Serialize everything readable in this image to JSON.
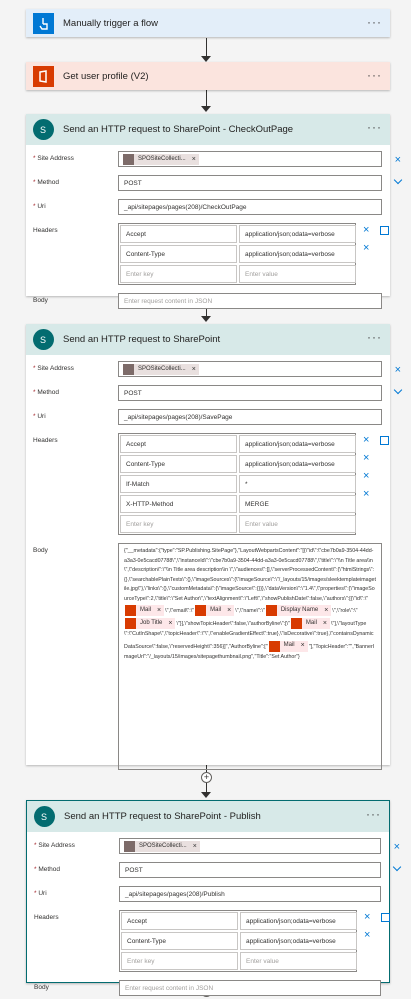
{
  "steps": {
    "trigger": {
      "title": "Manually trigger a flow"
    },
    "profile": {
      "title": "Get user profile (V2)"
    },
    "checkout": {
      "title": "Send an HTTP request to SharePoint - CheckOutPage",
      "site_label": "Site Address",
      "site_token": "SPOSiteCollecti...",
      "method_label": "Method",
      "method": "POST",
      "uri_label": "Uri",
      "uri": "_api/sitepages/pages(208)/CheckOutPage",
      "headers_label": "Headers",
      "headers": [
        {
          "k": "Accept",
          "v": "application/json;odata=verbose"
        },
        {
          "k": "Content-Type",
          "v": "application/json;odata=verbose"
        }
      ],
      "key_ph": "Enter key",
      "val_ph": "Enter value",
      "body_label": "Body",
      "body_ph": "Enter request content in JSON"
    },
    "save": {
      "title": "Send an HTTP request to SharePoint",
      "site_label": "Site Address",
      "site_token": "SPOSiteCollecti...",
      "method_label": "Method",
      "method": "POST",
      "uri_label": "Uri",
      "uri": "_api/sitepages/pages(208)/SavePage",
      "headers_label": "Headers",
      "headers": [
        {
          "k": "Accept",
          "v": "application/json;odata=verbose"
        },
        {
          "k": "Content-Type",
          "v": "application/json;odata=verbose"
        },
        {
          "k": "If-Match",
          "v": "*"
        },
        {
          "k": "X-HTTP-Method",
          "v": "MERGE"
        }
      ],
      "key_ph": "Enter key",
      "val_ph": "Enter value",
      "body_label": "Body",
      "body_part1": "{\"__metadata\":{\"type\":\"SP.Publishing.SitePage\"},\"LayoutWebpartsContent\":\"[{\\\"id\\\":\\\"cbe7b0a9-3504-44dd-a3a3-0e5cacd07788\\\",\\\"instanceId\\\":\\\"cbe7b0a9-3504-44dd-a3a3-0e5cacd07788\\\",\\\"title\\\":\\\"\\\\n Title area\\\\n \\\",\\\"description\\\":\\\"\\\\n Title area description\\\\n \\\",\\\"audiences\\\":[],\\\"serverProcessedContent\\\":{\\\"htmlStrings\\\":{},\\\"searchablePlainTexts\\\":{},\\\"imageSources\\\":{\\\"imageSource\\\":\\\"/_layouts/15/images/sleektemplateimagetile.jpg\\\"},\\\"links\\\":{},\\\"customMetadata\\\":{\\\"imageSource\\\":{}}},\\\"dataVersion\\\":\\\"1.4\\\",\\\"properties\\\":{\\\"imageSourceType\\\":2,\\\"title\\\":\\\"Set Author\\\",\\\"textAlignment\\\":\\\"Left\\\",\\\"showPublishDate\\\":false,\\\"authors\\\":[{\\\"id\\\":\\\"",
      "tok_mail": "Mail",
      "tok_display": "Display Name",
      "tok_job": "Job Title",
      "t1": "\\\",\\\"email\\\":\\\"",
      "t2": "\\\",\\\"name\\\":\\\"",
      "t3": "\\\",\\\"role\\\":\\\"",
      "t4": "\\\"}],\\\"showTopicHeader\\\":false,\\\"authorByline\\\":[\\\"",
      "t5": "\\\"],\\\"layoutType\\\":\\\"CutInShape\\\",\\\"topicHeader\\\":\\\"\\\",\\\"enableGradientEffect\\\":true},\\\"isDecorative\\\":true},\\\"containsDynamicDataSource\\\":false,\\\"reservedHeight\\\":356}]\",\"AuthorByline\":[\"",
      "t6": "\"],\"TopicHeader\":\"\",\"BannerImageUrl\":\"/_layouts/15/images/sitepagethumbnail.png\",\"Title\":\"Set Author\"}"
    },
    "publish": {
      "title": "Send an HTTP request to SharePoint - Publish",
      "site_label": "Site Address",
      "site_token": "SPOSiteCollecti...",
      "method_label": "Method",
      "method": "POST",
      "uri_label": "Uri",
      "uri": "_api/sitepages/pages(208)/Publish",
      "headers_label": "Headers",
      "headers": [
        {
          "k": "Accept",
          "v": "application/json;odata=verbose"
        },
        {
          "k": "Content-Type",
          "v": "application/json;odata=verbose"
        }
      ],
      "key_ph": "Enter key",
      "val_ph": "Enter value",
      "body_label": "Body",
      "body_ph": "Enter request content in JSON"
    }
  },
  "required_mark": "*",
  "colors": {
    "trigger_bg": "#e3eef9",
    "trigger_icon": "#0078d4",
    "profile_bg": "#fbe4de",
    "office": "#d83b01",
    "sp_bg": "#d7e9e8",
    "sp_icon": "#036c70"
  }
}
